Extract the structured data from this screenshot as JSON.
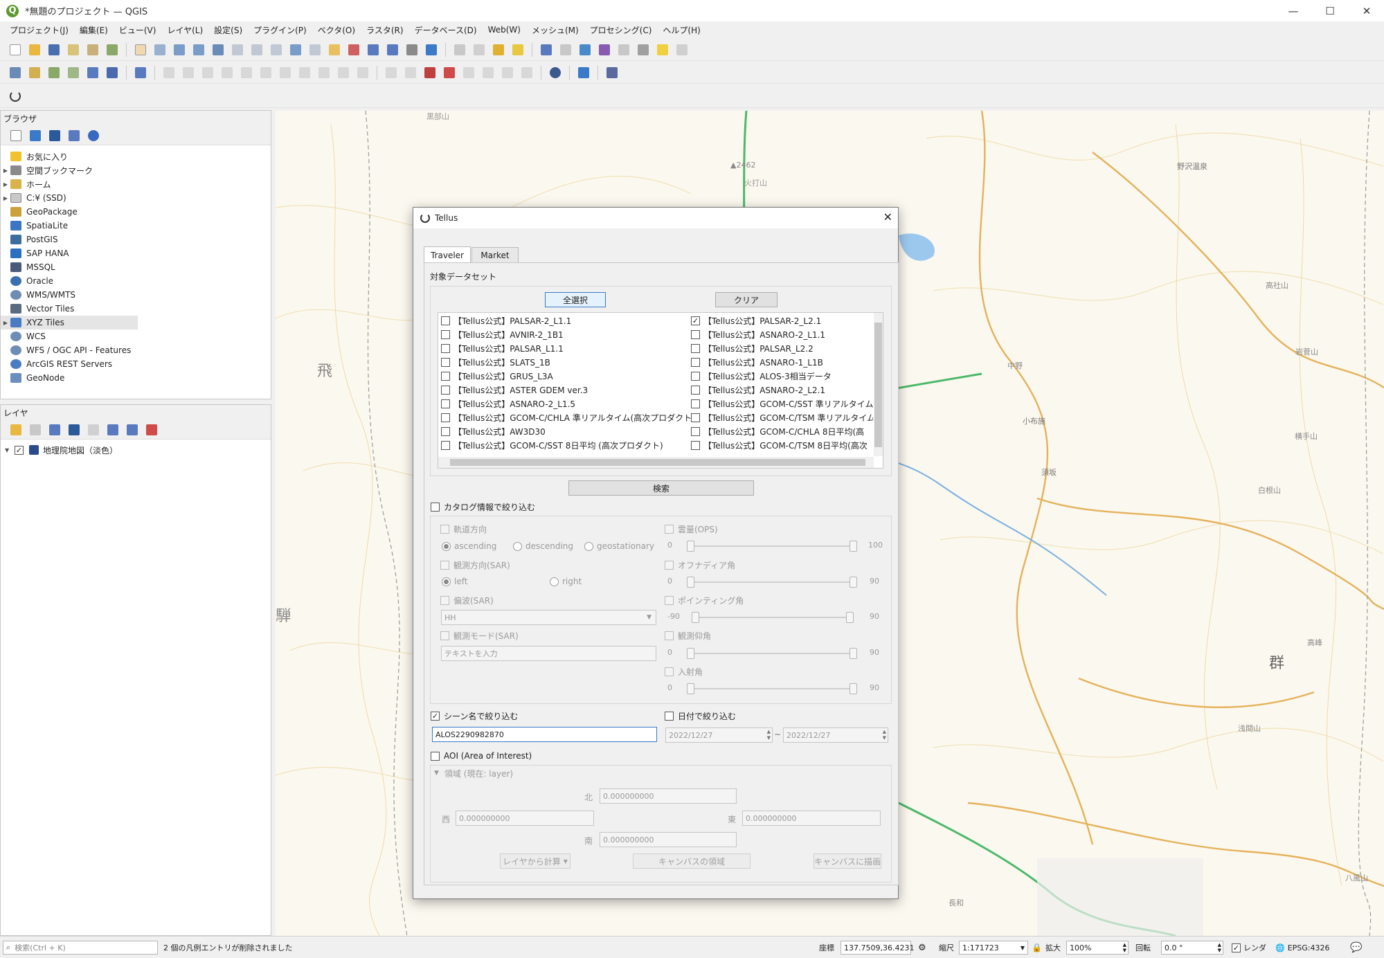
{
  "window": {
    "title": "*無題のプロジェクト — QGIS",
    "min": "—",
    "max": "☐",
    "close": "✕"
  },
  "menu": [
    "プロジェクト(J)",
    "編集(E)",
    "ビュー(V)",
    "レイヤ(L)",
    "設定(S)",
    "プラグイン(P)",
    "ベクタ(O)",
    "ラスタ(R)",
    "データベース(D)",
    "Web(W)",
    "メッシュ(M)",
    "プロセシング(C)",
    "ヘルプ(H)"
  ],
  "browser": {
    "title": "ブラウザ",
    "items": [
      {
        "label": "お気に入り",
        "icon": "star-icon",
        "color": "#f2c12e",
        "arrow": ""
      },
      {
        "label": "空間ブックマーク",
        "icon": "bookmark-icon",
        "color": "#8a8a8a",
        "arrow": "▶"
      },
      {
        "label": "ホーム",
        "icon": "home-folder-icon",
        "color": "#d9b34a",
        "arrow": "▶"
      },
      {
        "label": "C:¥ (SSD)",
        "icon": "drive-icon",
        "color": "#c9c9c9",
        "arrow": "▶"
      },
      {
        "label": "GeoPackage",
        "icon": "geopackage-icon",
        "color": "#caa13a",
        "arrow": ""
      },
      {
        "label": "SpatiaLite",
        "icon": "spatialite-icon",
        "color": "#3a76c4",
        "arrow": ""
      },
      {
        "label": "PostGIS",
        "icon": "postgis-icon",
        "color": "#3b6e9e",
        "arrow": ""
      },
      {
        "label": "SAP HANA",
        "icon": "sap-hana-icon",
        "color": "#2b6fc0",
        "arrow": ""
      },
      {
        "label": "MSSQL",
        "icon": "mssql-icon",
        "color": "#4a5a7a",
        "arrow": ""
      },
      {
        "label": "Oracle",
        "icon": "oracle-icon",
        "color": "#3a6fb0",
        "arrow": ""
      },
      {
        "label": "WMS/WMTS",
        "icon": "wms-icon",
        "color": "#6d8db5",
        "arrow": ""
      },
      {
        "label": "Vector Tiles",
        "icon": "vector-tiles-icon",
        "color": "#5a6a80",
        "arrow": ""
      },
      {
        "label": "XYZ Tiles",
        "icon": "xyz-tiles-icon",
        "color": "#4a7cc4",
        "arrow": "▶"
      },
      {
        "label": "WCS",
        "icon": "wcs-icon",
        "color": "#6d8db5",
        "arrow": ""
      },
      {
        "label": "WFS / OGC API - Features",
        "icon": "wfs-icon",
        "color": "#6d8db5",
        "arrow": ""
      },
      {
        "label": "ArcGIS REST Servers",
        "icon": "arcgis-icon",
        "color": "#4a7cc4",
        "arrow": ""
      },
      {
        "label": "GeoNode",
        "icon": "geonode-icon",
        "color": "#6a8fbf",
        "arrow": ""
      }
    ]
  },
  "layers": {
    "title": "レイヤ",
    "items": [
      {
        "label": "地理院地図（淡色）",
        "checked": "✓",
        "icon": "tile-layer-icon"
      }
    ]
  },
  "map_labels": [
    {
      "t": "黒部山",
      "c": "#999"
    },
    {
      "t": "▲2462",
      "c": "#888"
    },
    {
      "t": "火打山",
      "c": "#999"
    },
    {
      "t": "飛",
      "c": "#888"
    },
    {
      "t": "騨",
      "c": "#888"
    },
    {
      "t": "群",
      "c": "#666"
    },
    {
      "t": "野沢温泉",
      "c": "#777"
    },
    {
      "t": "高社山",
      "c": "#888"
    },
    {
      "t": "岩菅山",
      "c": "#888"
    },
    {
      "t": "横手山",
      "c": "#888"
    },
    {
      "t": "白根山",
      "c": "#888"
    },
    {
      "t": "浅間山",
      "c": "#888"
    },
    {
      "t": "中野",
      "c": "#888"
    },
    {
      "t": "小布施",
      "c": "#777"
    },
    {
      "t": "須坂",
      "c": "#777"
    },
    {
      "t": "長和",
      "c": "#888"
    },
    {
      "t": "八風山",
      "c": "#888"
    },
    {
      "t": "高峰",
      "c": "#888"
    }
  ],
  "dialog": {
    "title": "Tellus",
    "close": "✕",
    "tabs": [
      "Traveler",
      "Market"
    ],
    "dataset_label": "対象データセット",
    "select_all": "全選択",
    "clear": "クリア",
    "datasets_left": [
      {
        "label": "【Tellus公式】PALSAR-2_L1.1",
        "checked": ""
      },
      {
        "label": "【Tellus公式】AVNIR-2_1B1",
        "checked": ""
      },
      {
        "label": "【Tellus公式】PALSAR_L1.1",
        "checked": ""
      },
      {
        "label": "【Tellus公式】SLATS_1B",
        "checked": ""
      },
      {
        "label": "【Tellus公式】GRUS_L3A",
        "checked": ""
      },
      {
        "label": "【Tellus公式】ASTER GDEM ver.3",
        "checked": ""
      },
      {
        "label": "【Tellus公式】ASNARO-2_L1.5",
        "checked": ""
      },
      {
        "label": "【Tellus公式】GCOM-C/CHLA 準リアルタイム(高次プロダクト)",
        "checked": ""
      },
      {
        "label": "【Tellus公式】AW3D30",
        "checked": ""
      },
      {
        "label": "【Tellus公式】GCOM-C/SST 8日平均 (高次プロダクト)",
        "checked": ""
      }
    ],
    "datasets_right": [
      {
        "label": "【Tellus公式】PALSAR-2_L2.1",
        "checked": "✓"
      },
      {
        "label": "【Tellus公式】ASNARO-2_L1.1",
        "checked": ""
      },
      {
        "label": "【Tellus公式】PALSAR_L2.2",
        "checked": ""
      },
      {
        "label": "【Tellus公式】ASNARO-1_L1B",
        "checked": ""
      },
      {
        "label": "【Tellus公式】ALOS-3相当データ",
        "checked": ""
      },
      {
        "label": "【Tellus公式】ASNARO-2_L2.1",
        "checked": ""
      },
      {
        "label": "【Tellus公式】GCOM-C/SST 準リアルタイム(",
        "checked": ""
      },
      {
        "label": "【Tellus公式】GCOM-C/TSM 準リアルタイム(",
        "checked": ""
      },
      {
        "label": "【Tellus公式】GCOM-C/CHLA 8日平均(高",
        "checked": ""
      },
      {
        "label": "【Tellus公式】GCOM-C/TSM 8日平均(高次",
        "checked": ""
      }
    ],
    "search": "検索",
    "catalog_filter": "カタログ情報で絞り込む",
    "orbit": "軌道方向",
    "ascending": "ascending",
    "descending": "descending",
    "geostationary": "geostationary",
    "look": "観測方向(SAR)",
    "left": "left",
    "right": "right",
    "polarization": "偏波(SAR)",
    "pol_value": "HH",
    "obs_mode": "観測モード(SAR)",
    "obs_placeholder": "テキストを入力",
    "cloud": "雲量(OPS)",
    "cloud_min": "0",
    "cloud_max": "100",
    "off_nadir": "オフナディア角",
    "off_min": "0",
    "off_max": "90",
    "pointing": "ポインティング角",
    "pt_min": "-90",
    "pt_max": "90",
    "elevation": "観測仰角",
    "el_min": "0",
    "el_max": "90",
    "incidence": "入射角",
    "in_min": "0",
    "in_max": "90",
    "scene_filter": "シーン名で絞り込む",
    "scene_checked": "✓",
    "scene_value": "ALOS2290982870",
    "date_filter": "日付で絞り込む",
    "date_from": "2022/12/27",
    "date_sep": "~",
    "date_to": "2022/12/27",
    "aoi": "AOI (Area of Interest)",
    "extent": "領域 (現在: layer)",
    "north": "北",
    "south": "南",
    "west": "西",
    "east": "東",
    "north_v": "0.000000000",
    "south_v": "0.000000000",
    "west_v": "0.000000000",
    "east_v": "0.000000000",
    "from_layer": "レイヤから計算",
    "canvas_extent": "キャンバスの領域",
    "draw_canvas": "キャンバスに描画"
  },
  "status": {
    "search_placeholder": "検索(Ctrl + K)",
    "message": "2 個の凡例エントリが削除されました",
    "coord_label": "座標",
    "coord": "137.7509,36.4231",
    "scale_label": "縮尺",
    "scale": "1:171723",
    "zoom_label": "拡大",
    "zoom": "100%",
    "rotation_label": "回転",
    "rotation": "0.0 °",
    "render": "レンダ",
    "crs": "EPSG:4326"
  }
}
